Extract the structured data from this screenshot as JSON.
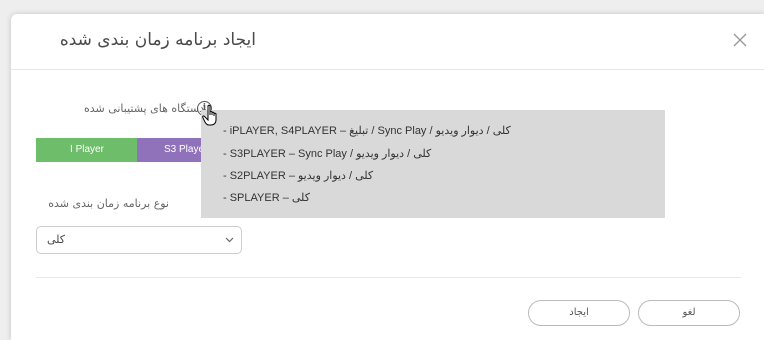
{
  "dialog": {
    "title": "ایجاد برنامه زمان بندی شده",
    "close_icon": "close-icon"
  },
  "devices": {
    "label": "دستگاه های پشتیبانی شده",
    "info_icon_glyph": "i",
    "chips": [
      {
        "label": "I Player",
        "color": "#6ebd6a"
      },
      {
        "label": "S3 Player",
        "color": "#8f72ba"
      },
      {
        "label": "",
        "color": "#e9a96b"
      }
    ]
  },
  "tooltip": {
    "lines": [
      "- iPLAYER, S4PLAYER – تبلیغ / Sync Play / کلی / دیوار ویدیو",
      "- S3PLAYER – Sync Play / کلی / دیوار ویدیو",
      "- S2PLAYER – کلی / دیوار ویدیو",
      "- SPLAYER – کلی"
    ]
  },
  "schedule_type": {
    "label": "نوع برنامه زمان بندی شده",
    "selected": "کلی"
  },
  "footer": {
    "create_label": "ایجاد",
    "cancel_label": "لغو"
  }
}
